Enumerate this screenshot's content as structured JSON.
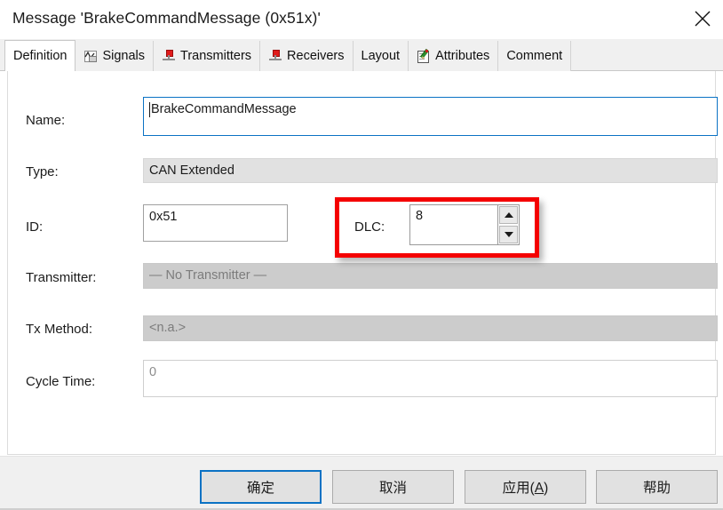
{
  "window": {
    "title": "Message 'BrakeCommandMessage (0x51x)'",
    "close_icon": "close-icon"
  },
  "tabs": [
    {
      "label": "Definition",
      "icon": "",
      "selected": true
    },
    {
      "label": "Signals",
      "icon": "signals-icon",
      "selected": false
    },
    {
      "label": "Transmitters",
      "icon": "transmitter-icon",
      "selected": false
    },
    {
      "label": "Receivers",
      "icon": "receiver-icon",
      "selected": false
    },
    {
      "label": "Layout",
      "icon": "",
      "selected": false
    },
    {
      "label": "Attributes",
      "icon": "attributes-icon",
      "selected": false
    },
    {
      "label": "Comment",
      "icon": "",
      "selected": false
    }
  ],
  "form": {
    "name": {
      "label": "Name:",
      "value": "BrakeCommandMessage"
    },
    "type": {
      "label": "Type:",
      "value": "CAN Extended"
    },
    "id": {
      "label": "ID:",
      "value": "0x51"
    },
    "dlc": {
      "label": "DLC:",
      "value": "8",
      "up_icon": "spinner-up-icon",
      "down_icon": "spinner-down-icon"
    },
    "transmitter": {
      "label": "Transmitter:",
      "value": "— No Transmitter —"
    },
    "tx_method": {
      "label": "Tx Method:",
      "value": "<n.a.>"
    },
    "cycle_time": {
      "label": "Cycle Time:",
      "value": "0"
    }
  },
  "annotation": {
    "color": "#f40000",
    "target": "dlc-field"
  },
  "buttons": {
    "ok": "确定",
    "cancel": "取消",
    "apply_prefix": "应用(",
    "apply_accel": "A",
    "apply_suffix": ")",
    "help": "帮助"
  },
  "colors": {
    "accent": "#0b72c4",
    "highlight": "#f40000",
    "readonly_dark": "#cccccc",
    "readonly_light": "#e1e1e1"
  }
}
